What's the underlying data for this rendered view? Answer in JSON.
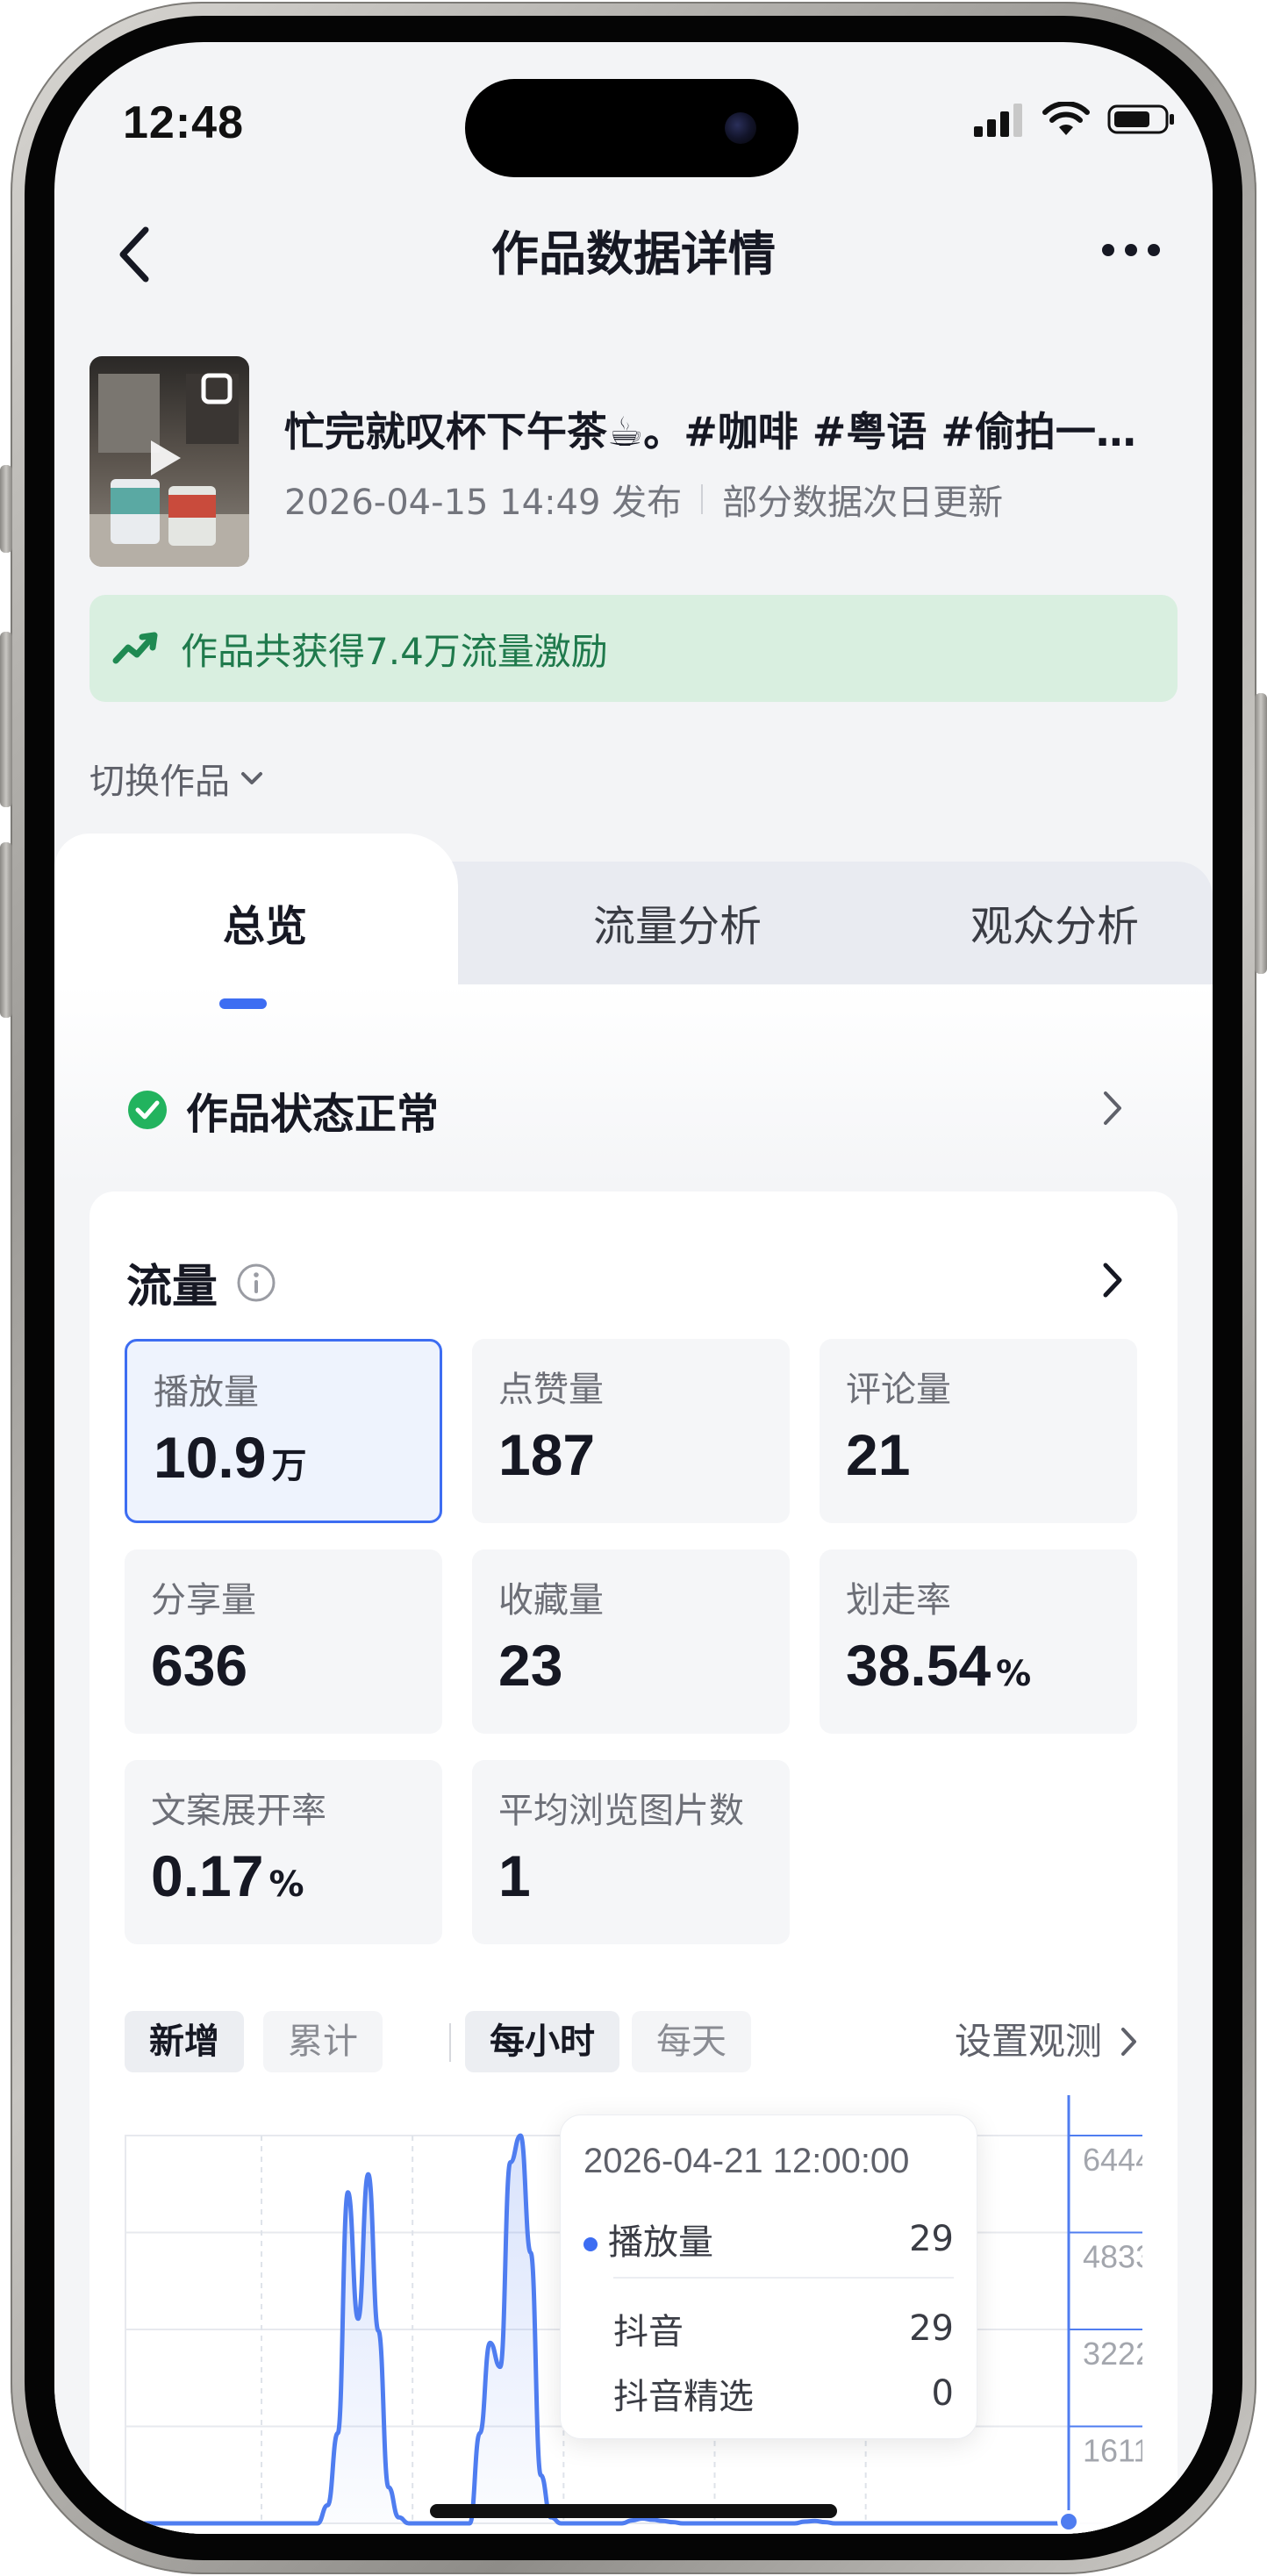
{
  "status_bar": {
    "time": "12:48"
  },
  "nav": {
    "title": "作品数据详情"
  },
  "video": {
    "title": "忙完就叹杯下午茶☕。#咖啡 #粤语 #偷拍一…",
    "publish_time": "2026-04-15 14:49 发布",
    "update_note": "部分数据次日更新"
  },
  "banner": {
    "text": "作品共获得7.4万流量激励",
    "color": "#1f7a4c"
  },
  "switch_label": "切换作品",
  "tabs": [
    {
      "label": "总览",
      "active": true
    },
    {
      "label": "流量分析",
      "active": false
    },
    {
      "label": "观众分析",
      "active": false
    }
  ],
  "work_status": {
    "text": "作品状态正常",
    "color": "#22b35e"
  },
  "traffic": {
    "title": "流量",
    "metrics": [
      {
        "label": "播放量",
        "value": "10.9",
        "unit": "万",
        "selected": true
      },
      {
        "label": "点赞量",
        "value": "187",
        "unit": ""
      },
      {
        "label": "评论量",
        "value": "21",
        "unit": ""
      },
      {
        "label": "分享量",
        "value": "636",
        "unit": ""
      },
      {
        "label": "收藏量",
        "value": "23",
        "unit": ""
      },
      {
        "label": "划走率",
        "value": "38.54",
        "unit": "%"
      },
      {
        "label": "文案展开率",
        "value": "0.17",
        "unit": "%"
      },
      {
        "label": "平均浏览图片数",
        "value": "1",
        "unit": ""
      }
    ]
  },
  "chart_controls": {
    "mode": [
      "新增",
      "累计"
    ],
    "granularity": [
      "每小时",
      "每天"
    ],
    "observe_label": "设置观测"
  },
  "chart_data": {
    "type": "area",
    "series": [
      {
        "name": "播放量",
        "values": [
          0,
          0,
          0,
          0,
          0,
          0,
          0,
          0,
          0,
          0,
          0,
          0,
          0,
          0,
          0,
          0,
          0,
          0,
          0,
          0,
          300,
          1500,
          5500,
          3400,
          5800,
          3200,
          600,
          100,
          0,
          0,
          0,
          0,
          0,
          0,
          0,
          1500,
          3000,
          2600,
          6000,
          6444,
          4500,
          800,
          100,
          0,
          0,
          0,
          0,
          0,
          0,
          0,
          50,
          80,
          60,
          40,
          20,
          0,
          0,
          0,
          0,
          0,
          0,
          0,
          0,
          0,
          0,
          0,
          0,
          30,
          40,
          20,
          0,
          0,
          0,
          0,
          0,
          0,
          0,
          0,
          0,
          0,
          0,
          0,
          0,
          0,
          0,
          0,
          0,
          0,
          0,
          0,
          0,
          0,
          0,
          29
        ]
      }
    ],
    "yticks": [
      "6444",
      "4833",
      "3222",
      "1611"
    ],
    "ylim": [
      0,
      6444
    ],
    "color": "#4f7df0",
    "tooltip": {
      "time": "2026-04-21 12:00:00",
      "series_name": "播放量",
      "total": "29",
      "rows": [
        {
          "name": "抖音",
          "value": "29"
        },
        {
          "name": "抖音精选",
          "value": "0"
        }
      ]
    }
  }
}
